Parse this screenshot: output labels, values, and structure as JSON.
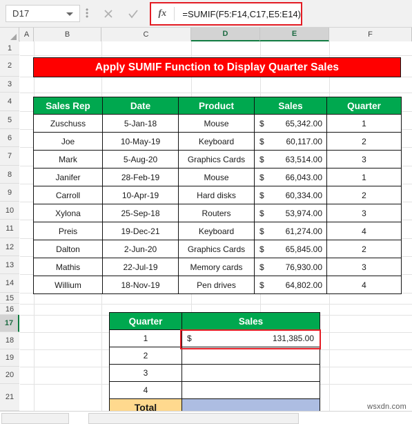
{
  "formula_bar": {
    "name_box_value": "D17",
    "cancel_icon": "close-icon",
    "confirm_icon": "check-icon",
    "fx_label": "fx",
    "formula": "=SUMIF(F5:F14,C17,E5:E14)"
  },
  "columns": [
    "A",
    "B",
    "C",
    "D",
    "E",
    "F"
  ],
  "selected_columns": [
    "D",
    "E"
  ],
  "rows": [
    "1",
    "2",
    "3",
    "4",
    "5",
    "6",
    "7",
    "8",
    "9",
    "10",
    "11",
    "12",
    "13",
    "14",
    "15",
    "16",
    "17",
    "18",
    "19",
    "20",
    "21"
  ],
  "selected_row": "17",
  "title_banner": {
    "text": "Apply SUMIF Function to Display Quarter Sales"
  },
  "main_table": {
    "headers": [
      "Sales Rep",
      "Date",
      "Product",
      "Sales",
      "Quarter"
    ],
    "rows": [
      {
        "rep": "Zuschuss",
        "date": "5-Jan-18",
        "product": "Mouse",
        "currency": "$",
        "sales": "65,342.00",
        "quarter": "1"
      },
      {
        "rep": "Joe",
        "date": "10-May-19",
        "product": "Keyboard",
        "currency": "$",
        "sales": "60,117.00",
        "quarter": "2"
      },
      {
        "rep": "Mark",
        "date": "5-Aug-20",
        "product": "Graphics Cards",
        "currency": "$",
        "sales": "63,514.00",
        "quarter": "3"
      },
      {
        "rep": "Janifer",
        "date": "28-Feb-19",
        "product": "Mouse",
        "currency": "$",
        "sales": "66,043.00",
        "quarter": "1"
      },
      {
        "rep": "Carroll",
        "date": "10-Apr-19",
        "product": "Hard disks",
        "currency": "$",
        "sales": "60,334.00",
        "quarter": "2"
      },
      {
        "rep": "Xylona",
        "date": "25-Sep-18",
        "product": "Routers",
        "currency": "$",
        "sales": "53,974.00",
        "quarter": "3"
      },
      {
        "rep": "Preis",
        "date": "19-Dec-21",
        "product": "Keyboard",
        "currency": "$",
        "sales": "61,274.00",
        "quarter": "4"
      },
      {
        "rep": "Dalton",
        "date": "2-Jun-20",
        "product": "Graphics Cards",
        "currency": "$",
        "sales": "65,845.00",
        "quarter": "2"
      },
      {
        "rep": "Mathis",
        "date": "22-Jul-19",
        "product": "Memory cards",
        "currency": "$",
        "sales": "76,930.00",
        "quarter": "3"
      },
      {
        "rep": "Willium",
        "date": "18-Nov-19",
        "product": "Pen drives",
        "currency": "$",
        "sales": "64,802.00",
        "quarter": "4"
      }
    ]
  },
  "summary_table": {
    "headers": [
      "Quarter",
      "Sales"
    ],
    "rows": [
      {
        "quarter": "1",
        "currency": "$",
        "sales": "131,385.00"
      },
      {
        "quarter": "2",
        "currency": "",
        "sales": ""
      },
      {
        "quarter": "3",
        "currency": "",
        "sales": ""
      },
      {
        "quarter": "4",
        "currency": "",
        "sales": ""
      }
    ],
    "total_label": "Total",
    "total_value": ""
  },
  "watermark": "wsxdn.com",
  "colors": {
    "header_green": "#00a84f",
    "banner_red": "#ff0000",
    "highlight_red": "#e31b23",
    "total_label_bg": "#ffd98e",
    "total_value_bg": "#adbde2"
  }
}
